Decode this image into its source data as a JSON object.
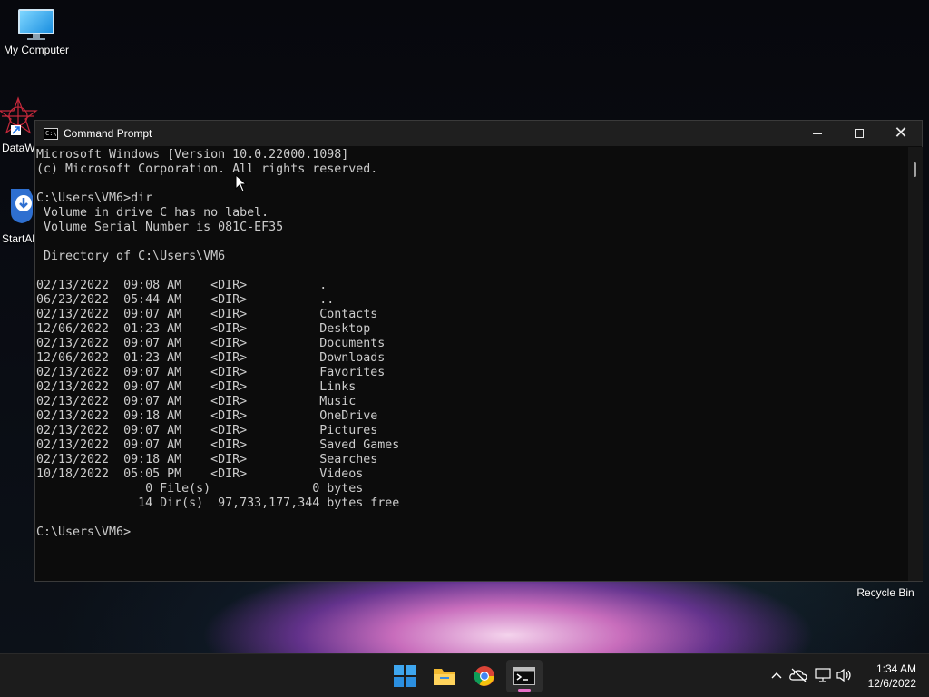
{
  "desktop": {
    "icons": [
      {
        "label": "My Computer",
        "icon": "monitor-icon"
      },
      {
        "label": "DataW",
        "icon": "datawatch-icon"
      },
      {
        "label": "StartAl",
        "icon": "download-shield-icon"
      }
    ],
    "recycle_bin_label": "Recycle Bin"
  },
  "window": {
    "title": "Command Prompt",
    "icon": "cmd-app-icon",
    "controls": [
      "minimize",
      "maximize",
      "close"
    ]
  },
  "console": {
    "lines": [
      "Microsoft Windows [Version 10.0.22000.1098]",
      "(c) Microsoft Corporation. All rights reserved.",
      "",
      "C:\\Users\\VM6>dir",
      " Volume in drive C has no label.",
      " Volume Serial Number is 081C-EF35",
      "",
      " Directory of C:\\Users\\VM6",
      "",
      "02/13/2022  09:08 AM    <DIR>          .",
      "06/23/2022  05:44 AM    <DIR>          ..",
      "02/13/2022  09:07 AM    <DIR>          Contacts",
      "12/06/2022  01:23 AM    <DIR>          Desktop",
      "02/13/2022  09:07 AM    <DIR>          Documents",
      "12/06/2022  01:23 AM    <DIR>          Downloads",
      "02/13/2022  09:07 AM    <DIR>          Favorites",
      "02/13/2022  09:07 AM    <DIR>          Links",
      "02/13/2022  09:07 AM    <DIR>          Music",
      "02/13/2022  09:18 AM    <DIR>          OneDrive",
      "02/13/2022  09:07 AM    <DIR>          Pictures",
      "02/13/2022  09:07 AM    <DIR>          Saved Games",
      "02/13/2022  09:18 AM    <DIR>          Searches",
      "10/18/2022  05:05 PM    <DIR>          Videos",
      "               0 File(s)              0 bytes",
      "              14 Dir(s)  97,733,177,344 bytes free",
      "",
      "C:\\Users\\VM6>"
    ]
  },
  "taskbar": {
    "apps": [
      {
        "icon": "windows-start-icon"
      },
      {
        "icon": "file-explorer-icon"
      },
      {
        "icon": "chrome-icon"
      },
      {
        "icon": "terminal-icon",
        "active": true
      }
    ],
    "tray": [
      "chevron-up-icon",
      "onedrive-offline-icon",
      "network-icon",
      "volume-icon"
    ],
    "time": "1:34 AM",
    "date": "12/6/2022"
  },
  "colors": {
    "console_bg": "#0c0c0c",
    "console_fg": "#cccccc",
    "taskbar_bg": "#1c1c1c",
    "active_indicator": "#e86fc8"
  }
}
